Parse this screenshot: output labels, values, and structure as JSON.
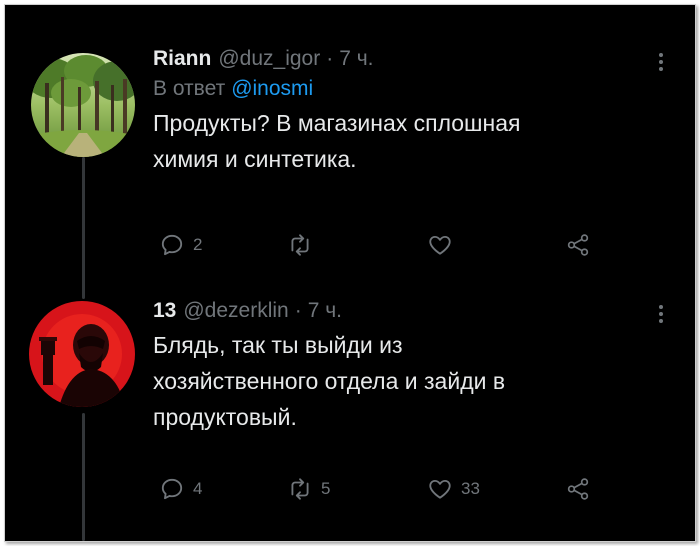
{
  "tweets": [
    {
      "name": "Riann",
      "handle": "@duz_igor",
      "separator": "·",
      "time": "7 ч.",
      "reply_prefix": "В ответ",
      "reply_mention": "@inosmi",
      "text_lines": [
        "Продукты?  В магазинах сплошная",
        "химия и синтетика."
      ],
      "replies": "2",
      "retweets": "",
      "likes": "",
      "avatar": "forest-photo"
    },
    {
      "name": "13",
      "handle": "@dezerklin",
      "separator": "·",
      "time": "7 ч.",
      "text_lines": [
        "Блядь, так ты выйди из",
        "хозяйственного отдела и зайди в",
        "продуктовый."
      ],
      "replies": "4",
      "retweets": "5",
      "likes": "33",
      "avatar": "red-portrait-with-fist"
    }
  ],
  "icons": {
    "reply": "speech-bubble-icon",
    "retweet": "retweet-arrows-icon",
    "like": "heart-outline-icon",
    "share": "share-nodes-icon",
    "more": "vertical-ellipsis-icon"
  },
  "colors": {
    "background": "#000000",
    "text": "#e7e9ea",
    "muted": "#71767b",
    "link": "#1d9bf0",
    "thread_line": "#333639"
  }
}
